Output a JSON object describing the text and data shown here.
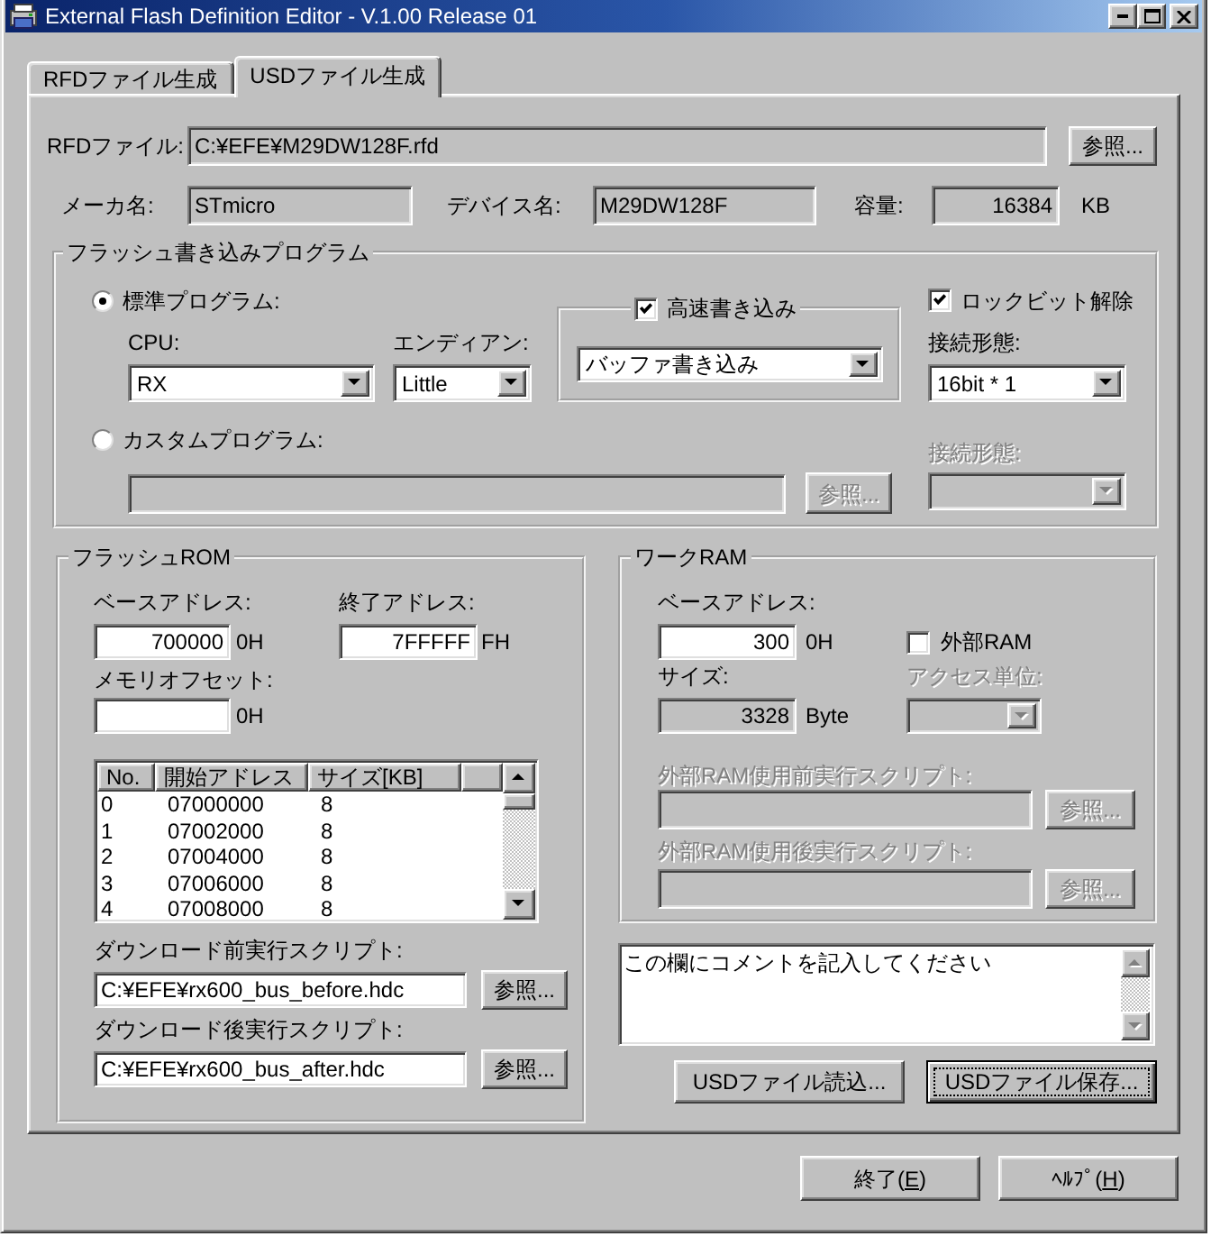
{
  "window": {
    "title": "External Flash Definition Editor - V.1.00 Release 01"
  },
  "tabs": [
    {
      "label": "RFDファイル生成",
      "selected": false
    },
    {
      "label": "USDファイル生成",
      "selected": true
    }
  ],
  "rfd_file": {
    "label": "RFDファイル:",
    "value": "C:¥EFE¥M29DW128F.rfd",
    "read_only": true,
    "button": "参照..."
  },
  "device_info": [
    {
      "label": "メーカ名:",
      "value": "STmicro",
      "read_only": true
    },
    {
      "label": "デバイス名:",
      "value": "M29DW128F",
      "read_only": true
    },
    {
      "label": "容量:",
      "value": "16384",
      "read_only": true,
      "unit": "KB"
    }
  ],
  "flash_program": {
    "title": "フラッシュ書き込みプログラム",
    "program_types": [
      {
        "label": "標準プログラム:",
        "selected": true
      },
      {
        "label": "カスタムプログラム:",
        "selected": false
      }
    ],
    "cpu": {
      "label": "CPU:",
      "value": "RX"
    },
    "endian": {
      "label": "エンディアン:",
      "value": "Little"
    },
    "fast_write": {
      "label": "高速書き込み",
      "checked": true,
      "value": "バッファ書き込み"
    },
    "lock_bit_release": {
      "label": "ロックビット解除",
      "checked": true
    },
    "connection": {
      "label": "接続形態:",
      "value": "16bit * 1"
    },
    "custom_file": {
      "disabled": true,
      "button": "参照..."
    },
    "custom_connection": {
      "label": "接続形態:",
      "disabled": true
    }
  },
  "flash_rom": {
    "title": "フラッシュROM",
    "base_address": {
      "label": "ベースアドレス:",
      "value": "700000",
      "suffix": "0H"
    },
    "end_address": {
      "label": "終了アドレス:",
      "value": "7FFFFF",
      "suffix": "FH"
    },
    "memory_offset": {
      "label": "メモリオフセット:",
      "suffix": "0H"
    },
    "sector_table": {
      "columns": [
        "No.",
        "開始アドレス",
        "サイズ[KB]"
      ],
      "rows": [
        [
          "0",
          "07000000",
          "8"
        ],
        [
          "1",
          "07002000",
          "8"
        ],
        [
          "2",
          "07004000",
          "8"
        ],
        [
          "3",
          "07006000",
          "8"
        ],
        [
          "4",
          "07008000",
          "8"
        ]
      ]
    },
    "pre_script": {
      "label": "ダウンロード前実行スクリプト:",
      "value": "C:¥EFE¥rx600_bus_before.hdc",
      "button": "参照..."
    },
    "post_script": {
      "label": "ダウンロード後実行スクリプト:",
      "value": "C:¥EFE¥rx600_bus_after.hdc",
      "button": "参照..."
    }
  },
  "work_ram": {
    "title": "ワークRAM",
    "base_address": {
      "label": "ベースアドレス:",
      "value": "300",
      "suffix": "0H"
    },
    "external_ram": {
      "label": "外部RAM",
      "checked": false
    },
    "size": {
      "label": "サイズ:",
      "value": "3328",
      "read_only": true,
      "unit": "Byte"
    },
    "access_unit": {
      "label": "アクセス単位:",
      "disabled": true
    },
    "pre_script": {
      "label": "外部RAM使用前実行スクリプト:",
      "button": "参照...",
      "disabled": true
    },
    "post_script": {
      "label": "外部RAM使用後実行スクリプト:",
      "button": "参照...",
      "disabled": true
    }
  },
  "comment": {
    "value": "この欄にコメントを記入してください"
  },
  "file_buttons": [
    {
      "label": "USDファイル読込...",
      "focused": false
    },
    {
      "label": "USDファイル保存...",
      "focused": true
    }
  ],
  "dialog_buttons": [
    {
      "label": "終了(",
      "access_key": "E",
      "label_end": ")"
    },
    {
      "label": "ﾍﾙﾌﾟ(",
      "access_key": "H",
      "label_end": ")"
    }
  ]
}
